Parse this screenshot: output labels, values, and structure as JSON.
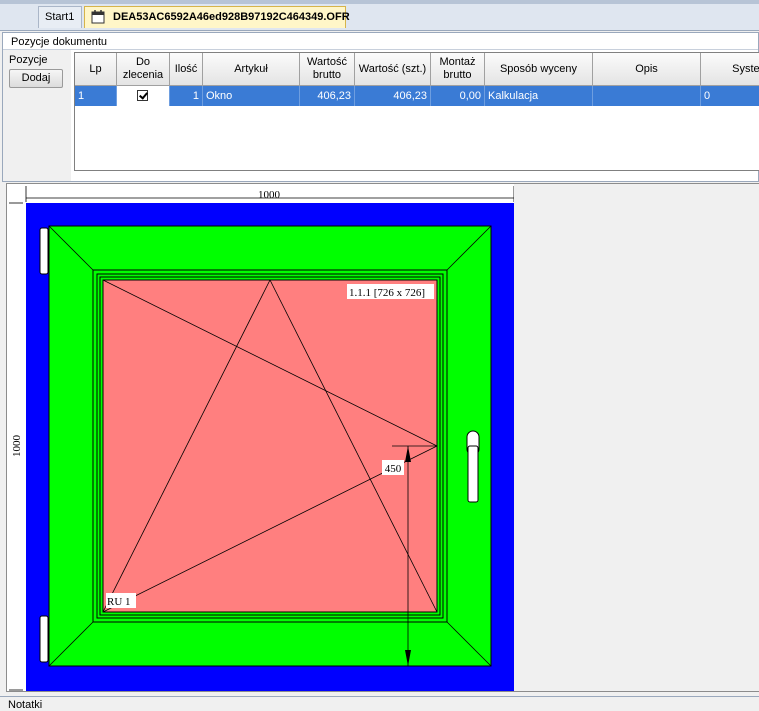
{
  "tabs": {
    "start_label": "Start1",
    "document_label": "DEA53AC6592A46ed928B97192C464349.OFR"
  },
  "panel": {
    "title": "Pozycje dokumentu",
    "side_label": "Pozycje",
    "add_button": "Dodaj"
  },
  "grid": {
    "columns": [
      "Lp",
      "Do zlecenia",
      "Ilość",
      "Artykuł",
      "Wartość brutto",
      "Wartość (szt.)",
      "Montaż brutto",
      "Sposób wyceny",
      "Opis",
      "System"
    ],
    "row": {
      "lp": "1",
      "do_zlecenia": true,
      "ilosc": "1",
      "artykul": "Okno",
      "wartosc_brutto": "406,23",
      "wartosc_szt": "406,23",
      "montaz_brutto": "0,00",
      "sposob_wyceny": "Kalkulacja",
      "opis": "",
      "system": "0"
    }
  },
  "drawing": {
    "width_label": "1000",
    "height_label": "1000",
    "sash_label": "1.1.1 [726 x 726]",
    "handle_dim": "450",
    "opening_label": "RU 1",
    "colors": {
      "frame": "#0000ff",
      "sash": "#00ff00",
      "glass": "#ff7f7f"
    }
  },
  "footer": {
    "notes_label": "Notatki"
  }
}
